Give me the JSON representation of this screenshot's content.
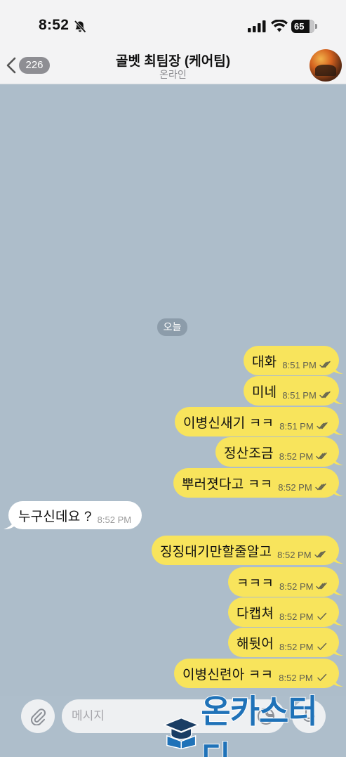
{
  "status_bar": {
    "time": "8:52",
    "battery": "65",
    "icons": [
      "bell-slash-icon",
      "signal-icon",
      "wifi-icon",
      "battery-icon"
    ]
  },
  "header": {
    "unread_count": "226",
    "title": "골벳 최팀장 (케어팀)",
    "status": "온라인",
    "icons": [
      "chevron-left-icon",
      "avatar"
    ]
  },
  "date_chip": "오늘",
  "messages": [
    {
      "dir": "out",
      "text": "대화",
      "time": "8:51 PM",
      "ticks": "double"
    },
    {
      "dir": "out",
      "text": "미네",
      "time": "8:51 PM",
      "ticks": "double"
    },
    {
      "dir": "out",
      "text": "이병신새기 ㅋㅋ",
      "time": "8:51 PM",
      "ticks": "double"
    },
    {
      "dir": "out",
      "text": "정산조금",
      "time": "8:52 PM",
      "ticks": "double"
    },
    {
      "dir": "out",
      "text": "뿌러졋다고 ㅋㅋ",
      "time": "8:52 PM",
      "ticks": "double"
    },
    {
      "dir": "in",
      "text": "누구신데요 ?",
      "time": "8:52 PM"
    },
    {
      "dir": "out",
      "text": "징징대기만할줄알고",
      "time": "8:52 PM",
      "ticks": "double"
    },
    {
      "dir": "out",
      "text": "ㅋㅋㅋ",
      "time": "8:52 PM",
      "ticks": "double"
    },
    {
      "dir": "out",
      "text": "다캡쳐",
      "time": "8:52 PM",
      "ticks": "single"
    },
    {
      "dir": "out",
      "text": "해뒷어",
      "time": "8:52 PM",
      "ticks": "single"
    },
    {
      "dir": "out",
      "text": "이병신련아 ㅋㅋ",
      "time": "8:52 PM",
      "ticks": "single"
    }
  ],
  "input": {
    "placeholder": "메시지",
    "icons": [
      "paperclip-icon",
      "sticker-icon",
      "microphone-icon"
    ]
  },
  "watermark": {
    "text": "온카스터디",
    "color": "#1f72b8"
  },
  "colors": {
    "chat_background": "#adbdca",
    "outgoing_bubble": "#f8e45c",
    "incoming_bubble": "#ffffff",
    "bar_background": "#f3f3f4"
  }
}
